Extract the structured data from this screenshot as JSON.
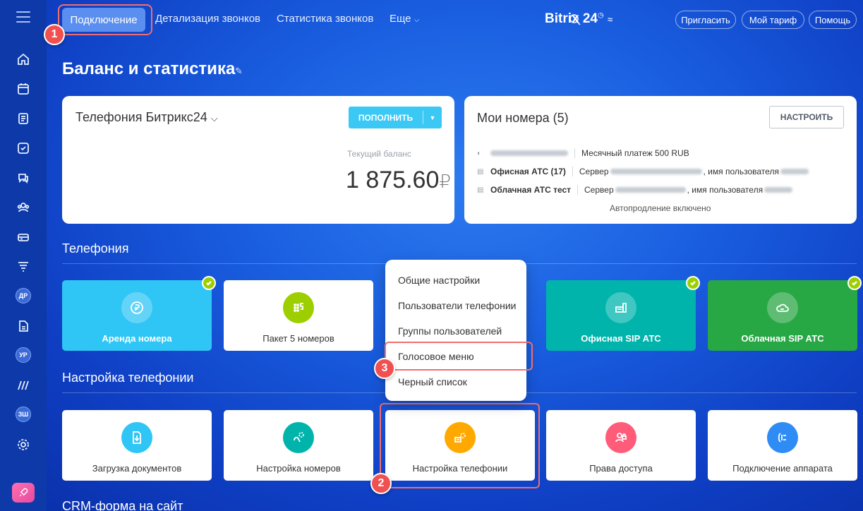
{
  "nav": {
    "items": [
      "Подключение",
      "Детализация звонков",
      "Статистика звонков",
      "Еще"
    ],
    "brand": "Bitrix 24",
    "invite": "Пригласить",
    "tariff": "Мой тариф",
    "help": "Помощь"
  },
  "sidebar": {
    "avatars": [
      "ДР",
      "УР",
      "ЗШ"
    ]
  },
  "page": {
    "title": "Баланс и статистика"
  },
  "balance_card": {
    "title": "Телефония Битрикс24",
    "topup_button": "ПОПОЛНИТЬ",
    "balance_label": "Текущий баланс",
    "balance_value": "1 875.60",
    "currency": "₽"
  },
  "numbers_card": {
    "title": "Мои номера (5)",
    "configure_button": "НАСТРОИТЬ",
    "rows": [
      {
        "label": "",
        "info": "Месячный платеж 500 RUB"
      },
      {
        "label": "Офисная АТС (17)",
        "info": "Сервер",
        "info2": ", имя пользователя"
      },
      {
        "label": "Облачная АТС тест",
        "info": "Сервер",
        "info2": ", имя пользователя"
      }
    ],
    "auto_renew": "Автопродление включено"
  },
  "sections": {
    "telephony": "Телефония",
    "telephony_setup": "Настройка телефонии",
    "crm": "CRM-форма на сайт"
  },
  "telephony_tiles": [
    {
      "label": "Аренда номера",
      "icon": "phone-ruble-icon",
      "bg": "#2fc6f6",
      "checked": true
    },
    {
      "label": "Пакет 5 номеров",
      "icon": "dialpad-5-icon",
      "bg": "#ffffff",
      "checked": false
    },
    {
      "label": "Офисная SIP АТС",
      "icon": "office-pbx-icon",
      "bg": "#00b4ac",
      "checked": true
    },
    {
      "label": "Облачная SIP АТС",
      "icon": "cloud-pbx-icon",
      "bg": "#28a745",
      "checked": true
    }
  ],
  "setup_tiles": [
    {
      "label": "Загрузка документов",
      "icon": "document-download-icon",
      "color": "#2fc6f6"
    },
    {
      "label": "Настройка номеров",
      "icon": "number-settings-icon",
      "color": "#00b4ac"
    },
    {
      "label": "Настройка телефонии",
      "icon": "telephony-settings-icon",
      "color": "#ffa900"
    },
    {
      "label": "Права доступа",
      "icon": "access-rights-icon",
      "color": "#ff5c7a"
    },
    {
      "label": "Подключение аппарата",
      "icon": "device-connect-icon",
      "color": "#2f8cf5"
    }
  ],
  "menu": {
    "items": [
      "Общие настройки",
      "Пользователи телефонии",
      "Группы пользователей",
      "Голосовое меню",
      "Черный список"
    ]
  },
  "markers": [
    "1",
    "2",
    "3"
  ],
  "colors": {
    "accent_red": "#f05050",
    "topup_blue": "#3bc8f5",
    "check_green": "#9dcf00"
  }
}
